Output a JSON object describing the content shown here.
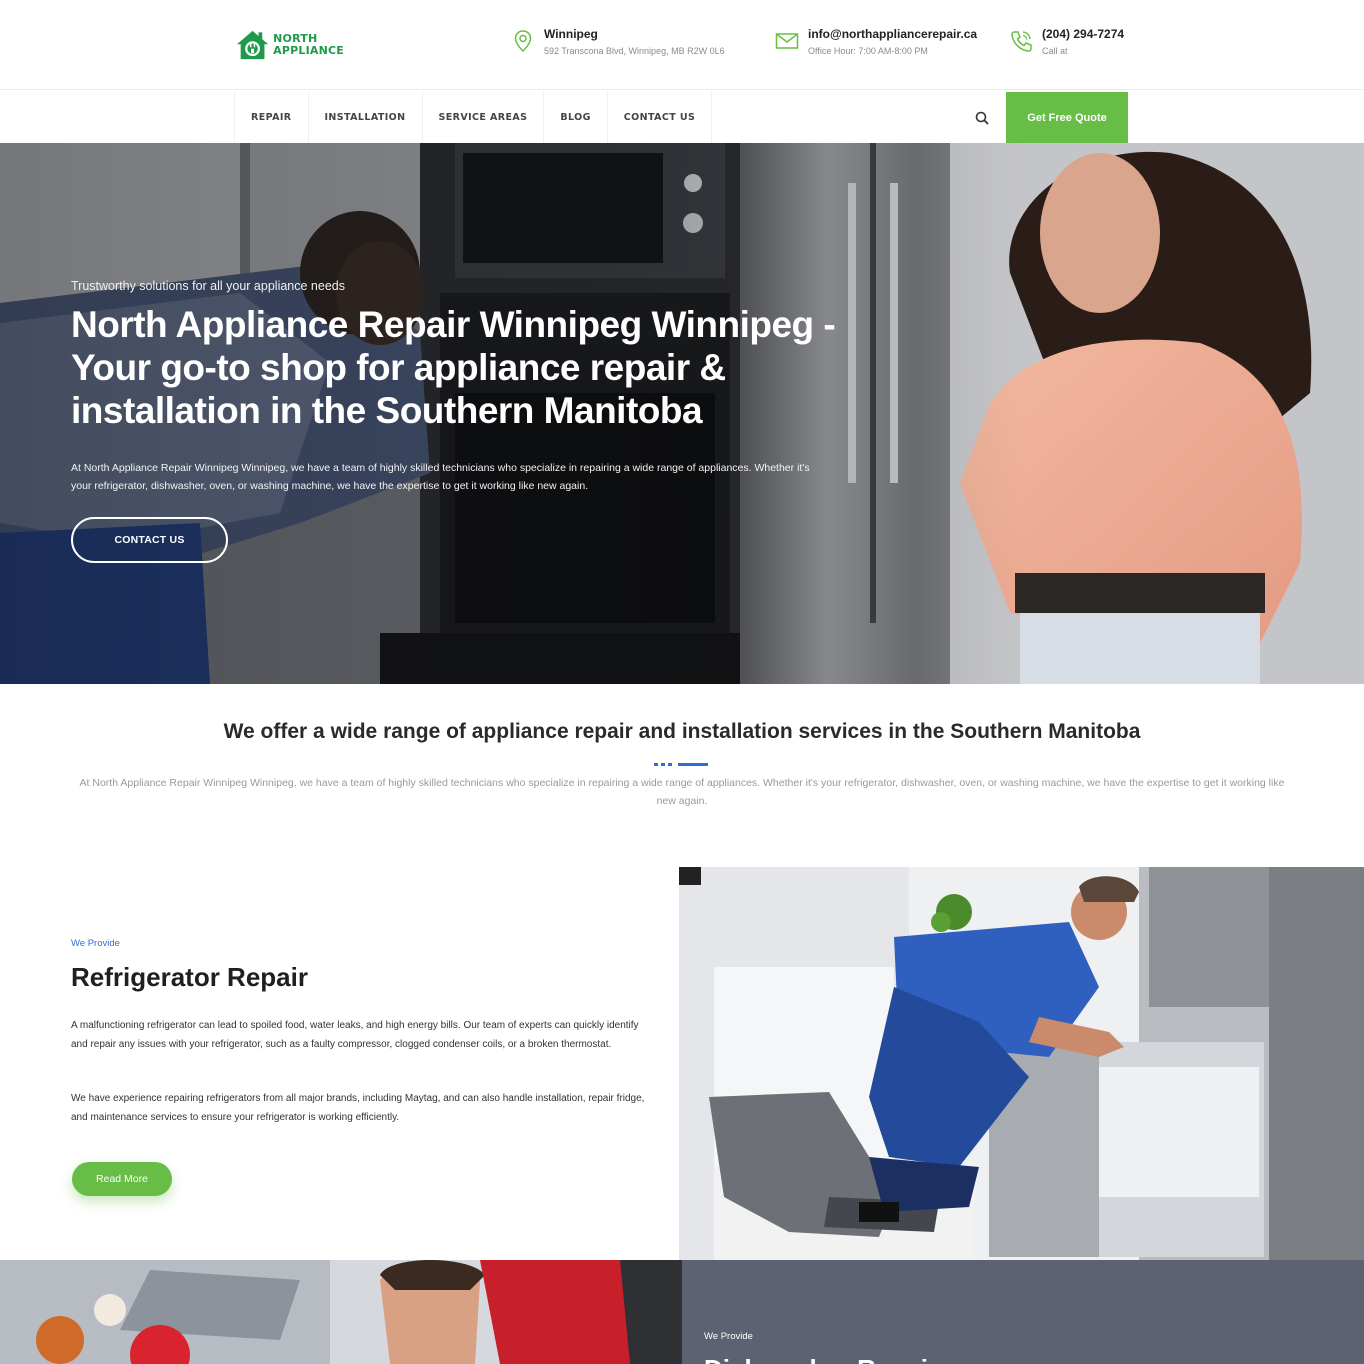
{
  "header": {
    "logo": {
      "line1": "NORTH",
      "line2": "APPLIANCE",
      "brand_color": "#1e9a4b"
    },
    "location": {
      "icon": "map-pin-icon",
      "title": "Winnipeg",
      "sub": "592 Transcona Blvd, Winnipeg, MB R2W 0L6"
    },
    "email": {
      "icon": "envelope-icon",
      "title": "info@northappliancerepair.ca",
      "sub": "Office Hour: 7:00 AM-8:00 PM"
    },
    "phone": {
      "icon": "phone-icon",
      "title": "(204) 294-7274",
      "sub": "Call at"
    }
  },
  "nav": {
    "items": [
      "REPAIR",
      "INSTALLATION",
      "SERVICE AREAS",
      "BLOG",
      "CONTACT US"
    ],
    "search_icon": "search-icon",
    "cta_label": "Get Free Quote",
    "accent": "#67bd45"
  },
  "hero": {
    "eyebrow": "Trustworthy solutions for all your appliance needs",
    "title": "North Appliance Repair Winnipeg Winnipeg - Your go-to shop for appliance repair & installation in the Southern Manitoba",
    "description": "At North Appliance Repair Winnipeg Winnipeg, we have a team of highly skilled technicians who specialize in repairing a wide range of appliances. Whether it's your refrigerator, dishwasher, oven, or washing machine, we have the expertise to get it working like new again.",
    "button": "CONTACT US"
  },
  "intro": {
    "title": "We offer a wide range of appliance repair and installation services in the Southern Manitoba",
    "text": "At North Appliance Repair Winnipeg Winnipeg, we have a team of highly skilled technicians who specialize in repairing a wide range of appliances. Whether it's your refrigerator, dishwasher, oven, or washing machine, we have the expertise to get it working like new again.",
    "accent": "#2f6fcf"
  },
  "refrigerator": {
    "eyebrow": "We Provide",
    "title": "Refrigerator Repair",
    "p1": "A malfunctioning refrigerator can lead to spoiled food, water leaks, and high energy bills. Our team of experts can quickly identify and repair any issues with your refrigerator, such as a faulty compressor, clogged condenser coils, or a broken thermostat.",
    "p2": "We have experience repairing refrigerators from all major brands, including Maytag, and can also handle installation, repair fridge, and maintenance services to ensure your refrigerator is working efficiently.",
    "button": "Read More"
  },
  "next_section": {
    "eyebrow": "We Provide",
    "title": "Dishwasher Repair",
    "panel_color": "#5d6272"
  }
}
